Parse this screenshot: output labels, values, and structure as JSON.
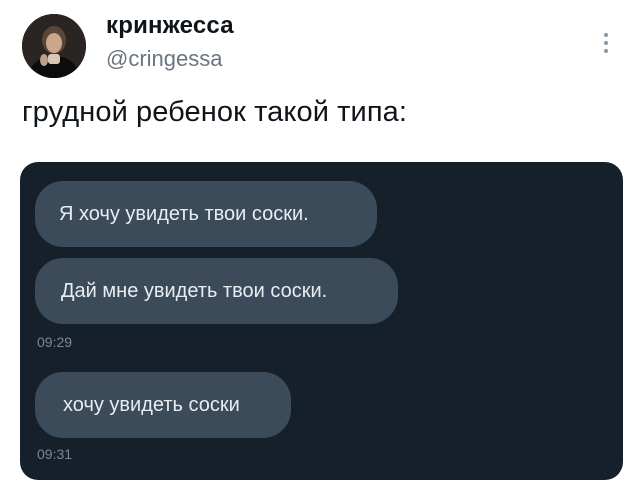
{
  "author": {
    "display_name": "кринжесса",
    "handle": "@cringessa"
  },
  "tweet": {
    "text": "грудной ребенок такой типа:"
  },
  "icons": {
    "more": "more-vertical-icon",
    "avatar": "profile-photo"
  },
  "media": {
    "messages": [
      {
        "text": "Я хочу увидеть твои соски.",
        "time": ""
      },
      {
        "text": "Дай мне увидеть твои соски.",
        "time": "09:29"
      },
      {
        "text": "хочу увидеть соски",
        "time": "09:31"
      }
    ],
    "colors": {
      "background": "#15202b",
      "bubble": "#3c4b5a",
      "bubble_text": "#e8edf1",
      "timestamp": "#7a8896"
    }
  }
}
